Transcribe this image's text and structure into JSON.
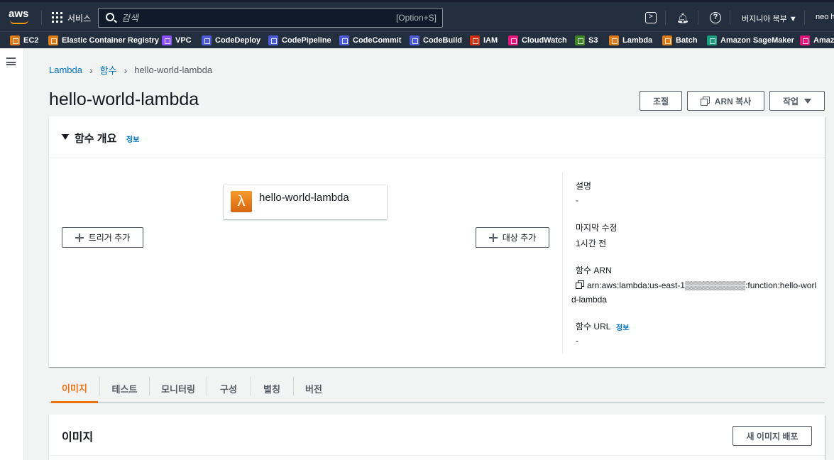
{
  "topnav": {
    "logo_text": "aws",
    "services_label": "서비스",
    "search_placeholder": "검색",
    "search_shortcut": "[Option+S]",
    "region": "버지니아 북부 ▼",
    "user": "neo h"
  },
  "favorites": [
    {
      "label": "EC2",
      "color": "#e07b1a"
    },
    {
      "label": "Elastic Container Registry",
      "color": "#e07b1a"
    },
    {
      "label": "VPC",
      "color": "#8c4fff"
    },
    {
      "label": "CodeDeploy",
      "color": "#4d5bd8"
    },
    {
      "label": "CodePipeline",
      "color": "#4d5bd8"
    },
    {
      "label": "CodeCommit",
      "color": "#4d5bd8"
    },
    {
      "label": "CodeBuild",
      "color": "#4d5bd8"
    },
    {
      "label": "IAM",
      "color": "#d13212"
    },
    {
      "label": "CloudWatch",
      "color": "#e7157b"
    },
    {
      "label": "S3",
      "color": "#3f8624"
    },
    {
      "label": "Lambda",
      "color": "#e07b1a"
    },
    {
      "label": "Batch",
      "color": "#e07b1a"
    },
    {
      "label": "Amazon SageMaker",
      "color": "#1a9c7c"
    },
    {
      "label": "Amazo",
      "color": "#e7157b"
    }
  ],
  "breadcrumb": {
    "items": [
      "Lambda",
      "함수"
    ],
    "current": "hello-world-lambda"
  },
  "page": {
    "title": "hello-world-lambda",
    "throttle_label": "조절",
    "copy_arn_label": "ARN 복사",
    "actions_label": "작업"
  },
  "overview": {
    "title": "함수 개요",
    "info_label": "정보",
    "function_name": "hello-world-lambda",
    "add_trigger_label": "트리거 추가",
    "add_destination_label": "대상 추가",
    "description_label": "설명",
    "description_value": "-",
    "last_modified_label": "마지막 수정",
    "last_modified_value": "1시간 전",
    "arn_label": "함수 ARN",
    "arn_value": "arn:aws:lambda:us-east-1▒▒▒▒▒▒▒▒▒▒:function:hello-world-lambda",
    "url_label": "함수 URL",
    "url_info_label": "정보",
    "url_value": "-"
  },
  "tabs": [
    "이미지",
    "테스트",
    "모니터링",
    "구성",
    "별칭",
    "버전"
  ],
  "image_section": {
    "title": "이미지",
    "deploy_label": "새 이미지 배포"
  },
  "colors": {
    "nav_bg": "#232f3e",
    "accent": "#ec7211",
    "link": "#0073bb"
  }
}
